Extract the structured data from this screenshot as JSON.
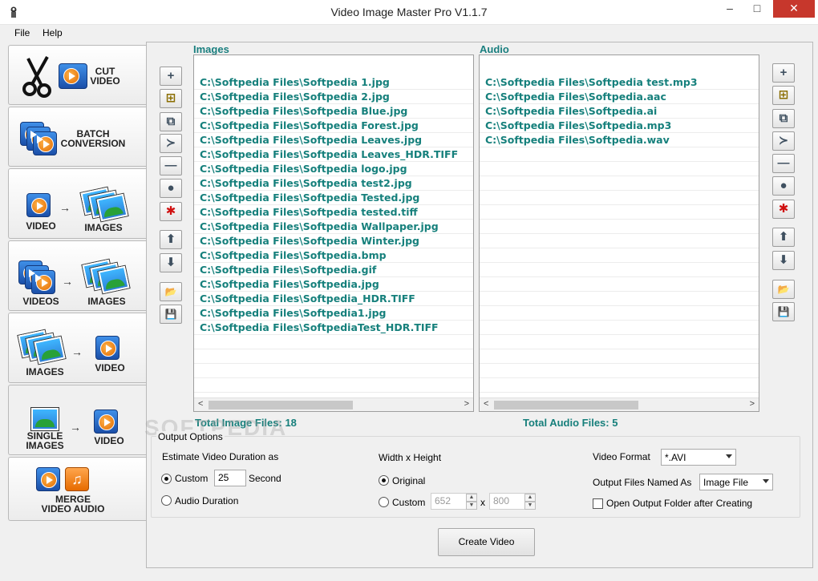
{
  "window": {
    "title": "Video Image Master Pro V1.1.7",
    "min": "–",
    "max": "□",
    "close": "✕"
  },
  "menu": [
    "File",
    "Help"
  ],
  "tabs": [
    {
      "label1": "CUT",
      "label2": "VIDEO"
    },
    {
      "label1": "BATCH",
      "label2": "CONVERSION"
    },
    {
      "left": "VIDEO",
      "right": "IMAGES"
    },
    {
      "left": "VIDEOS",
      "right": "IMAGES"
    },
    {
      "left": "IMAGES",
      "right": "VIDEO"
    },
    {
      "left1": "SINGLE",
      "left2": "IMAGES",
      "right": "VIDEO"
    },
    {
      "label1": "MERGE",
      "label2": "VIDEO AUDIO"
    }
  ],
  "images": {
    "header": "Images",
    "files": [
      "C:\\Softpedia Files\\Softpedia 1.jpg",
      "C:\\Softpedia Files\\Softpedia 2.jpg",
      "C:\\Softpedia Files\\Softpedia Blue.jpg",
      "C:\\Softpedia Files\\Softpedia Forest.jpg",
      "C:\\Softpedia Files\\Softpedia Leaves.jpg",
      "C:\\Softpedia Files\\Softpedia Leaves_HDR.TIFF",
      "C:\\Softpedia Files\\Softpedia logo.jpg",
      "C:\\Softpedia Files\\Softpedia test2.jpg",
      "C:\\Softpedia Files\\Softpedia Tested.jpg",
      "C:\\Softpedia Files\\Softpedia tested.tiff",
      "C:\\Softpedia Files\\Softpedia Wallpaper.jpg",
      "C:\\Softpedia Files\\Softpedia Winter.jpg",
      "C:\\Softpedia Files\\Softpedia.bmp",
      "C:\\Softpedia Files\\Softpedia.gif",
      "C:\\Softpedia Files\\Softpedia.jpg",
      "C:\\Softpedia Files\\Softpedia_HDR.TIFF",
      "C:\\Softpedia Files\\Softpedia1.jpg",
      "C:\\Softpedia Files\\SoftpediaTest_HDR.TIFF"
    ],
    "total": "Total Image Files: 18"
  },
  "audio": {
    "header": "Audio",
    "files": [
      "C:\\Softpedia Files\\Softpedia test.mp3",
      "C:\\Softpedia Files\\Softpedia.aac",
      "C:\\Softpedia Files\\Softpedia.ai",
      "C:\\Softpedia Files\\Softpedia.mp3",
      "C:\\Softpedia Files\\Softpedia.wav"
    ],
    "total": "Total Audio Files: 5"
  },
  "toolbar_glyphs": [
    "+",
    "⊞",
    "⧉",
    "≻",
    "—",
    "●",
    "✱",
    "⬆",
    "⬇",
    "📂",
    "💾"
  ],
  "output": {
    "title": "Output Options",
    "duration_label": "Estimate Video Duration as",
    "custom_label": "Custom",
    "custom_value": "25",
    "second_label": "Second",
    "audio_duration_label": "Audio Duration",
    "wh_label": "Width x Height",
    "original_label": "Original",
    "wh_custom_label": "Custom",
    "width_value": "652",
    "x_label": "x",
    "height_value": "800",
    "format_label": "Video Format",
    "format_value": "*.AVI",
    "named_label": "Output Files Named As",
    "named_value": "Image File",
    "open_folder_label": "Open Output Folder after Creating"
  },
  "create_button": "Create Video",
  "watermark": "SOFTPEDIA"
}
